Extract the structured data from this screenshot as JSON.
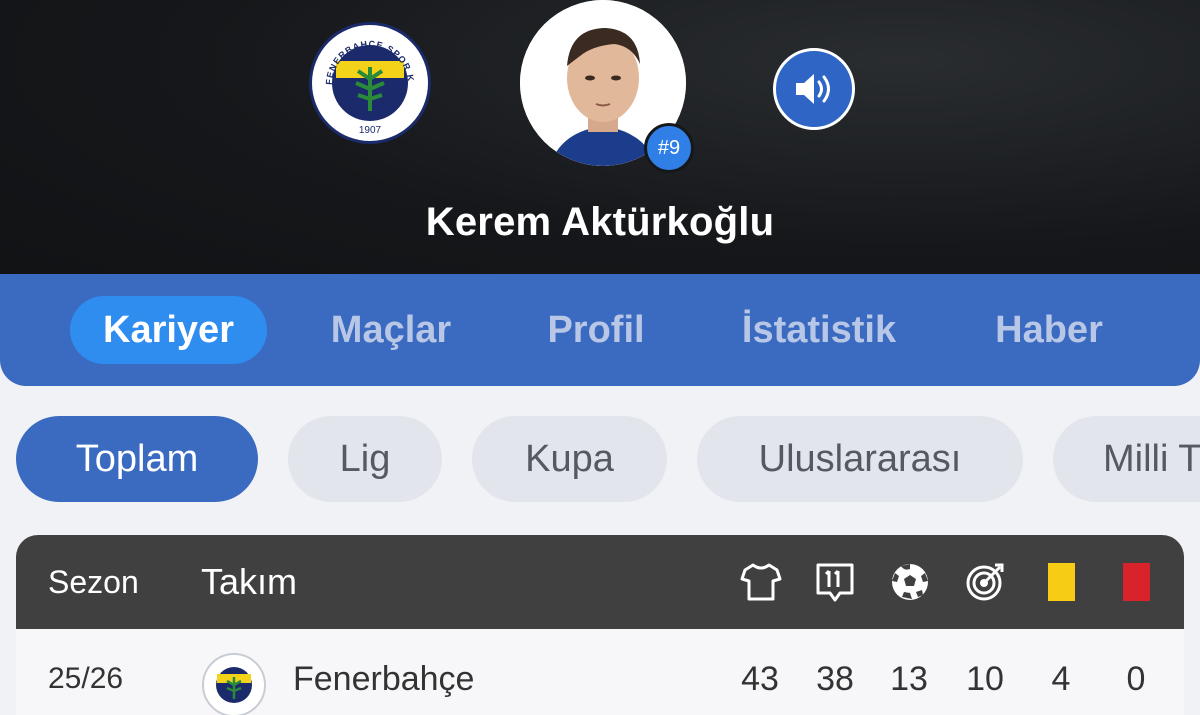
{
  "header": {
    "player_name": "Kerem Aktürkoğlu",
    "shirt_number": "#9",
    "club_logo": {
      "top_text": "FENERBAHÇE SPOR KULÜBÜ",
      "year": "1907",
      "icon": "fenerbahce-crest"
    },
    "sound_icon": "speaker-icon",
    "colors": {
      "badge": "#2f7fe6",
      "sound": "#2f65c4"
    }
  },
  "tabs": [
    {
      "label": "Kariyer",
      "active": true
    },
    {
      "label": "Maçlar",
      "active": false
    },
    {
      "label": "Profil",
      "active": false
    },
    {
      "label": "İstatistik",
      "active": false
    },
    {
      "label": "Haber",
      "active": false
    }
  ],
  "filters": [
    {
      "label": "Toplam",
      "active": true
    },
    {
      "label": "Lig",
      "active": false
    },
    {
      "label": "Kupa",
      "active": false
    },
    {
      "label": "Uluslararası",
      "active": false
    },
    {
      "label": "Milli T",
      "active": false
    }
  ],
  "table": {
    "headers": {
      "season": "Sezon",
      "team": "Takım",
      "icons": [
        "jersey-icon",
        "starting-eleven-icon",
        "football-icon",
        "target-icon",
        "yellow-card-icon",
        "red-card-icon"
      ]
    },
    "rows": [
      {
        "season": "25/26",
        "team": "Fenerbahçe",
        "appearances": "43",
        "starts": "38",
        "goals": "13",
        "assists": "10",
        "yellow_cards": "4",
        "red_cards": "0"
      }
    ]
  },
  "colors": {
    "primary": "#3a6bc1",
    "active_tab": "#2f8df0",
    "yellow_card": "#f6cc14",
    "red_card": "#d8232a"
  }
}
